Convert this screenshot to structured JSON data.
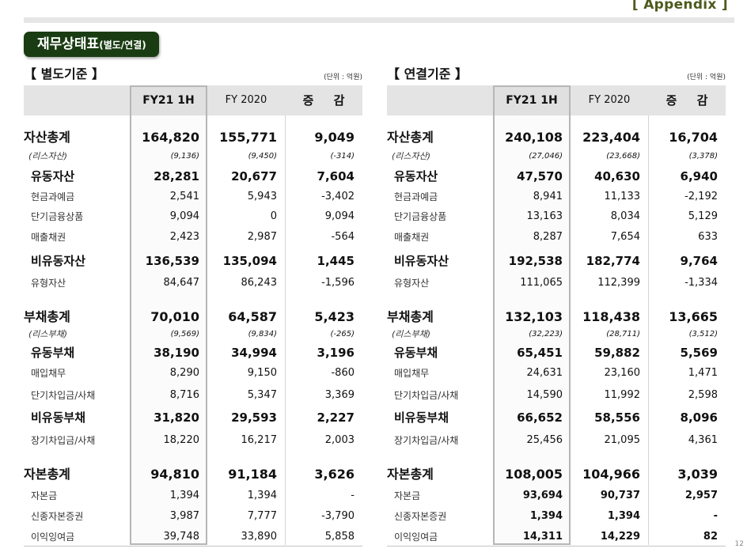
{
  "header": {
    "appendix": "[ Appendix ]"
  },
  "section": {
    "title": "재무상태표",
    "sub": "(별도/연결)"
  },
  "page_number": "12",
  "tables": [
    {
      "title": "【 별도기준 】",
      "unit": "(단위 : 억원)",
      "headers": [
        "FY21 1H",
        "FY 2020",
        "증 감"
      ],
      "rows": [
        {
          "label": "자산총계",
          "v": [
            "164,820",
            "155,771",
            "9,049"
          ]
        },
        {
          "label": "(리스자산)",
          "v": [
            "(9,136)",
            "(9,450)",
            "(-314)"
          ]
        },
        {
          "label": "유동자산",
          "v": [
            "28,281",
            "20,677",
            "7,604"
          ]
        },
        {
          "label": "현금과예금",
          "v": [
            "2,541",
            "5,943",
            "-3,402"
          ]
        },
        {
          "label": "단기금융상품",
          "v": [
            "9,094",
            "0",
            "9,094"
          ]
        },
        {
          "label": "매출채권",
          "v": [
            "2,423",
            "2,987",
            "-564"
          ]
        },
        {
          "label": "비유동자산",
          "v": [
            "136,539",
            "135,094",
            "1,445"
          ]
        },
        {
          "label": "유형자산",
          "v": [
            "84,647",
            "86,243",
            "-1,596"
          ]
        },
        {
          "label": "부채총계",
          "v": [
            "70,010",
            "64,587",
            "5,423"
          ]
        },
        {
          "label": "(리스부채)",
          "v": [
            "(9,569)",
            "(9,834)",
            "(-265)"
          ]
        },
        {
          "label": "유동부채",
          "v": [
            "38,190",
            "34,994",
            "3,196"
          ]
        },
        {
          "label": "매입채무",
          "v": [
            "8,290",
            "9,150",
            "-860"
          ]
        },
        {
          "label": "단기차입금/사채",
          "v": [
            "8,716",
            "5,347",
            "3,369"
          ]
        },
        {
          "label": "비유동부채",
          "v": [
            "31,820",
            "29,593",
            "2,227"
          ]
        },
        {
          "label": "장기차입금/사채",
          "v": [
            "18,220",
            "16,217",
            "2,003"
          ]
        },
        {
          "label": "자본총계",
          "v": [
            "94,810",
            "91,184",
            "3,626"
          ]
        },
        {
          "label": "자본금",
          "v": [
            "1,394",
            "1,394",
            "-"
          ]
        },
        {
          "label": "신종자본증권",
          "v": [
            "3,987",
            "7,777",
            "-3,790"
          ]
        },
        {
          "label": "이익잉여금",
          "v": [
            "39,748",
            "33,890",
            "5,858"
          ]
        }
      ]
    },
    {
      "title": "【 연결기준 】",
      "unit": "(단위 : 억원)",
      "headers": [
        "FY21 1H",
        "FY 2020",
        "증 감"
      ],
      "rows": [
        {
          "label": "자산총계",
          "v": [
            "240,108",
            "223,404",
            "16,704"
          ]
        },
        {
          "label": "(리스자산)",
          "v": [
            "(27,046)",
            "(23,668)",
            "(3,378)"
          ]
        },
        {
          "label": "유동자산",
          "v": [
            "47,570",
            "40,630",
            "6,940"
          ]
        },
        {
          "label": "현금과예금",
          "v": [
            "8,941",
            "11,133",
            "-2,192"
          ]
        },
        {
          "label": "단기금융상품",
          "v": [
            "13,163",
            "8,034",
            "5,129"
          ]
        },
        {
          "label": "매출채권",
          "v": [
            "8,287",
            "7,654",
            "633"
          ]
        },
        {
          "label": "비유동자산",
          "v": [
            "192,538",
            "182,774",
            "9,764"
          ]
        },
        {
          "label": "유형자산",
          "v": [
            "111,065",
            "112,399",
            "-1,334"
          ]
        },
        {
          "label": "부채총계",
          "v": [
            "132,103",
            "118,438",
            "13,665"
          ]
        },
        {
          "label": "(리스부채)",
          "v": [
            "(32,223)",
            "(28,711)",
            "(3,512)"
          ]
        },
        {
          "label": "유동부채",
          "v": [
            "65,451",
            "59,882",
            "5,569"
          ]
        },
        {
          "label": "매입채무",
          "v": [
            "24,631",
            "23,160",
            "1,471"
          ]
        },
        {
          "label": "단기차입금/사채",
          "v": [
            "14,590",
            "11,992",
            "2,598"
          ]
        },
        {
          "label": "비유동부채",
          "v": [
            "66,652",
            "58,556",
            "8,096"
          ]
        },
        {
          "label": "장기차입금/사채",
          "v": [
            "25,456",
            "21,095",
            "4,361"
          ]
        },
        {
          "label": "자본총계",
          "v": [
            "108,005",
            "104,966",
            "3,039"
          ]
        },
        {
          "label": "자본금",
          "v": [
            "93,694",
            "90,737",
            "2,957"
          ]
        },
        {
          "label": "신종자본증권",
          "v": [
            "1,394",
            "1,394",
            "-"
          ]
        },
        {
          "label": "이익잉여금",
          "v": [
            "14,311",
            "14,229",
            "82"
          ]
        }
      ]
    }
  ]
}
